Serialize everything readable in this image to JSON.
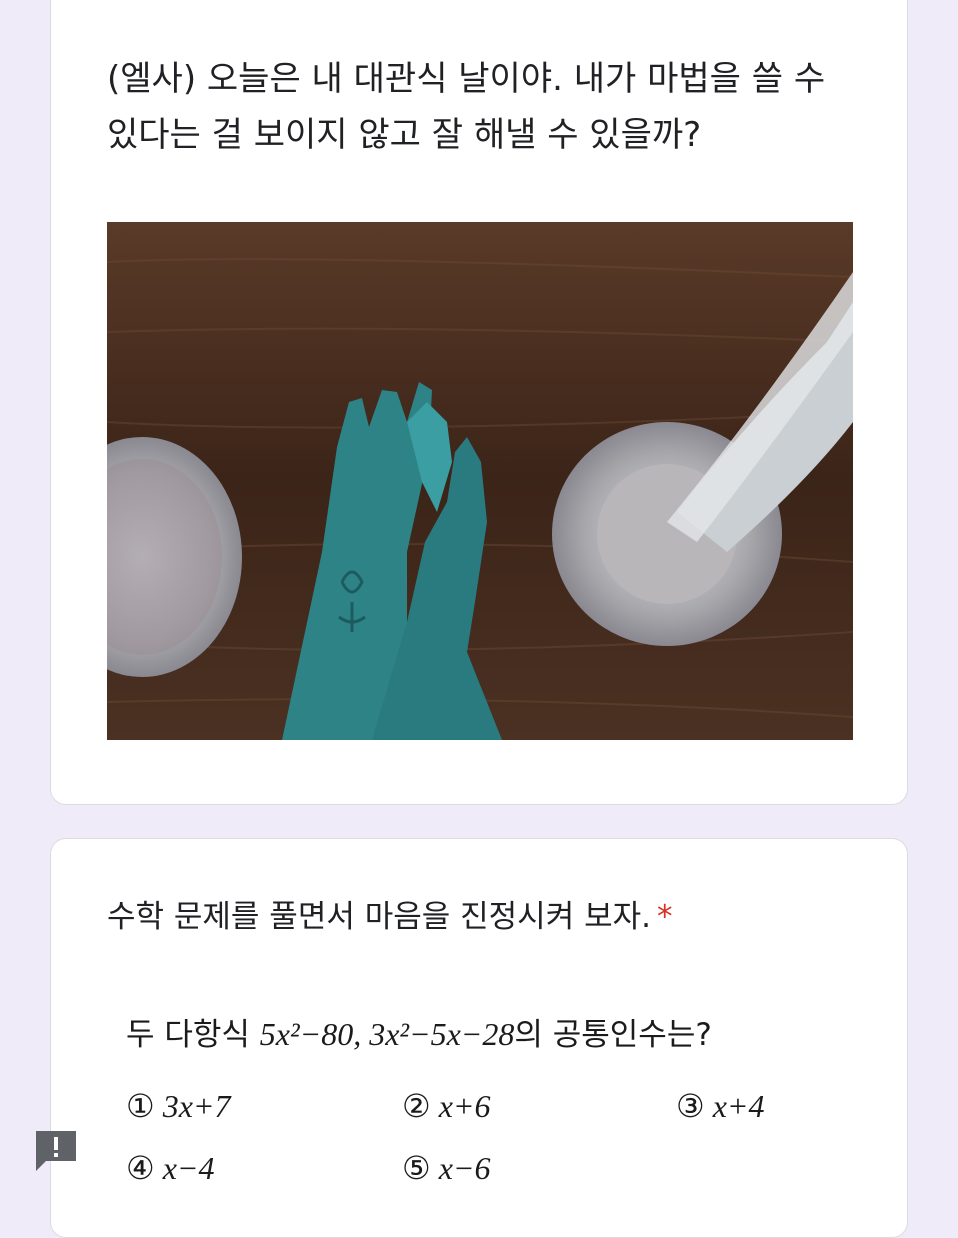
{
  "card1": {
    "text_line1": "(엘사) 오늘은 내 대관식 날이야. 내가 마법을 쓸 수",
    "text_line2": "있다는 걸 보이지 않고 잘 해낼 수 있을까?"
  },
  "card2": {
    "prompt": "수학 문제를 풀면서 마음을 진정시켜 보자.",
    "required_mark": "*",
    "problem": {
      "prefix": "두 다항식 ",
      "expr1": "5x²−80, 3x²−5x−28",
      "suffix": "의 공통인수는?"
    },
    "choices": [
      {
        "num": "①",
        "expr": "3x+7"
      },
      {
        "num": "②",
        "expr": "x+6"
      },
      {
        "num": "③",
        "expr": "x+4"
      },
      {
        "num": "④",
        "expr": "x−4"
      },
      {
        "num": "⑤",
        "expr": "x−6"
      }
    ]
  },
  "report_icon": "report-issue-icon",
  "colors": {
    "background": "#efebf8",
    "required": "#d93025",
    "glove": "#2f8d90"
  }
}
